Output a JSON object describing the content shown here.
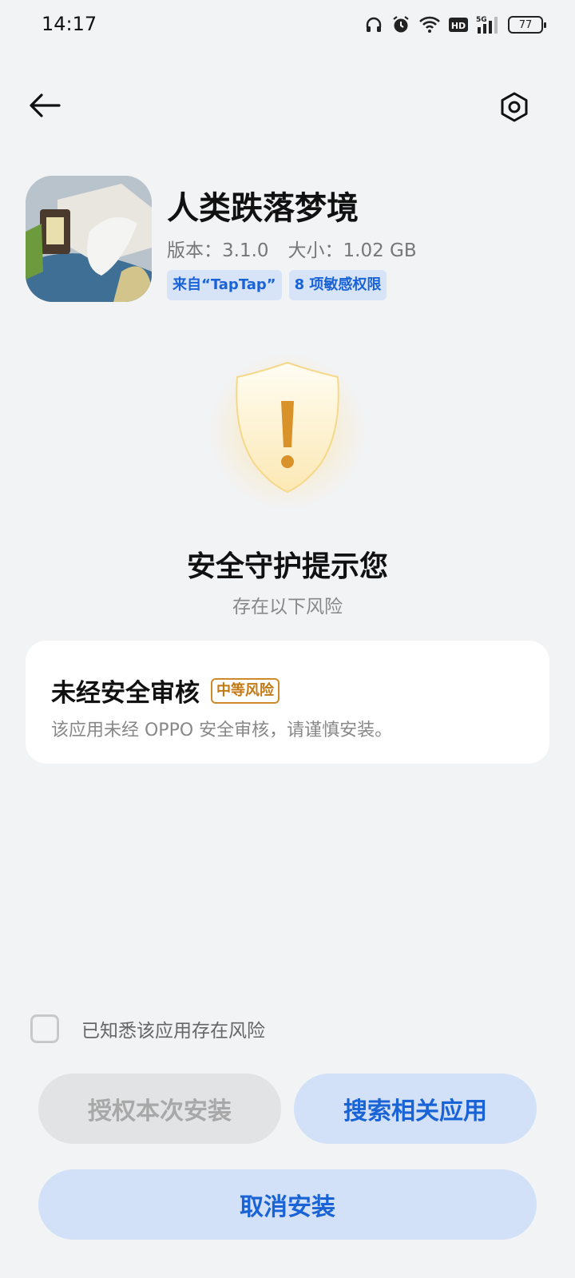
{
  "status_bar": {
    "time": "14:17",
    "battery": "77",
    "network": "5G",
    "hd": "HD",
    "icons": [
      "headphones-icon",
      "alarm-icon",
      "wifi-icon",
      "hd-icon",
      "signal-icon",
      "battery-icon"
    ]
  },
  "topbar": {
    "back_icon": "arrow-left-icon",
    "settings_icon": "hexagon-settings-icon"
  },
  "app": {
    "name": "人类跌落梦境",
    "version_text": "版本：3.1.0",
    "size_text": "大小：1.02 GB",
    "tags": [
      "来自“TapTap”",
      "8 项敏感权限"
    ]
  },
  "security": {
    "shield_icon": "warning-shield-icon",
    "title": "安全守护提示您",
    "subtitle": "存在以下风险"
  },
  "risk": {
    "title": "未经安全审核",
    "badge": "中等风险",
    "description": "该应用未经 OPPO 安全审核，请谨慎安装。"
  },
  "acknowledge": {
    "label": "已知悉该应用存在风险",
    "checked": false
  },
  "buttons": {
    "authorize": "授权本次安装",
    "search": "搜索相关应用",
    "cancel": "取消安装"
  },
  "colors": {
    "background": "#f2f3f5",
    "accent": "#1a63d6",
    "accent_bg": "#d2e1f7",
    "warning": "#c47a12",
    "disabled_bg": "#e2e3e5",
    "disabled_text": "#a8a8a8"
  }
}
